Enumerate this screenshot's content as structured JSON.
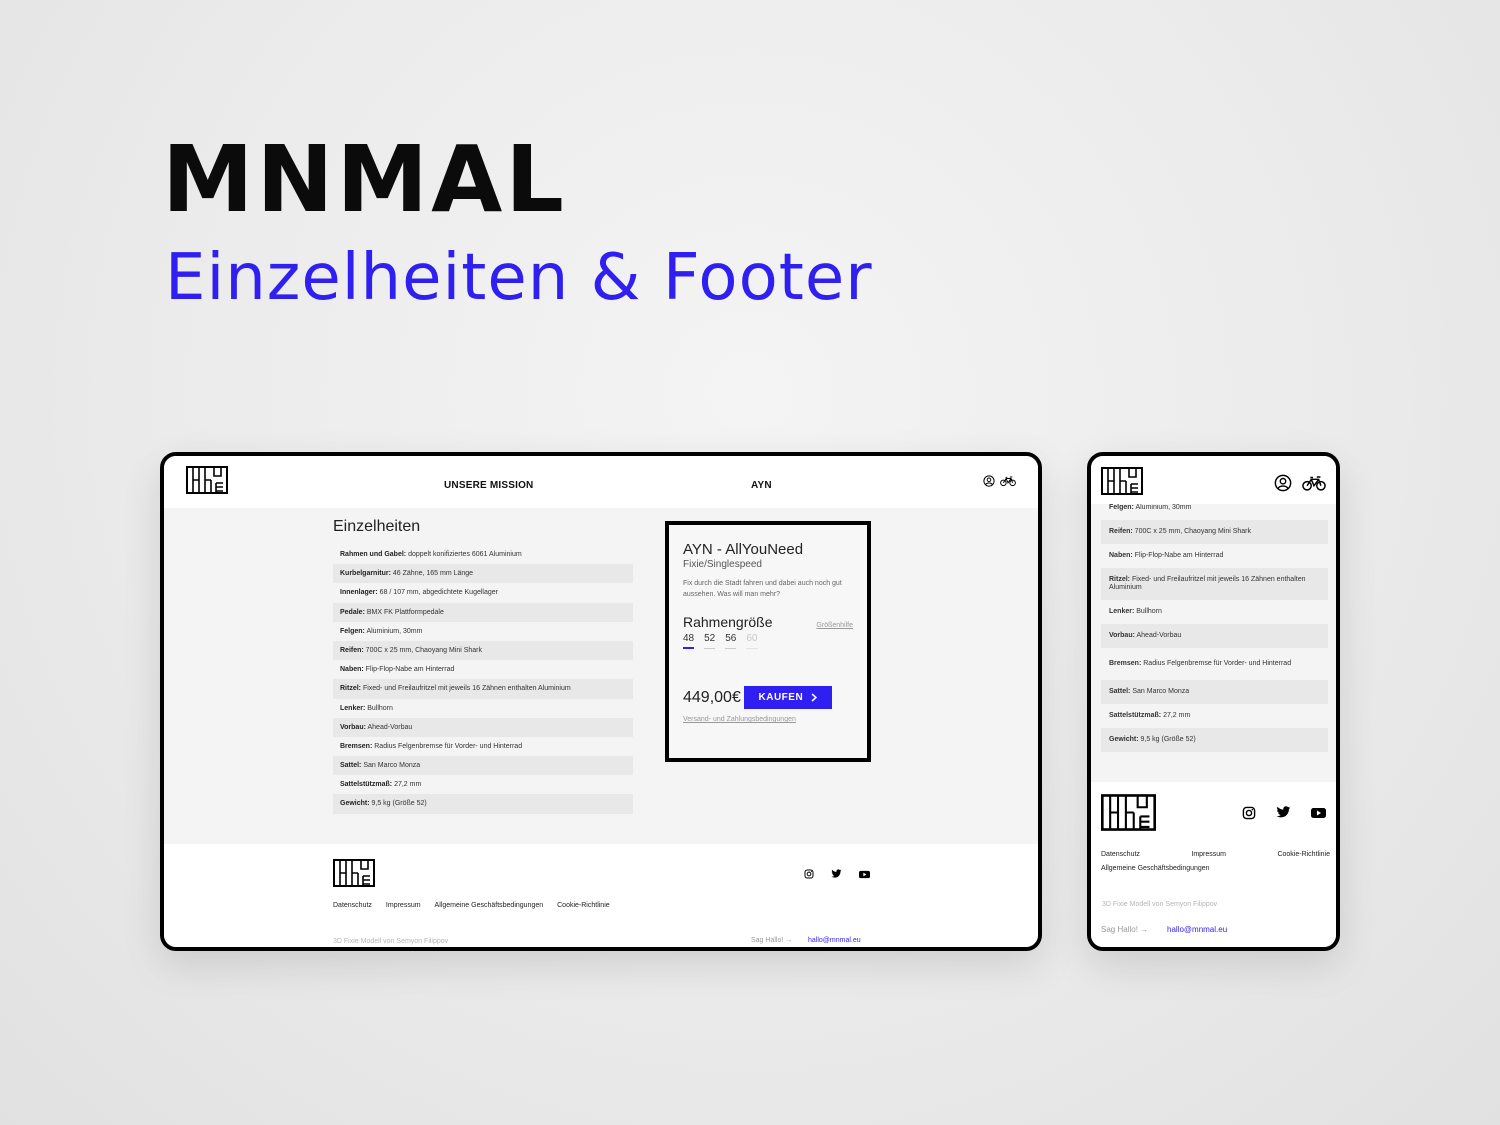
{
  "showcase": {
    "title": "MNMAL",
    "subtitle": "Einzelheiten & Footer"
  },
  "colors": {
    "accent": "#2f1ff0",
    "frame": "#000000",
    "panel": "#f4f4f4"
  },
  "icons": [
    "logo-mark",
    "user-icon",
    "bike-icon",
    "instagram-icon",
    "twitter-icon",
    "youtube-icon",
    "chevron-right-icon",
    "arrow-right-icon"
  ],
  "desktop": {
    "nav": {
      "mission": "UNSERE MISSION",
      "product": "AYN"
    },
    "section_title": "Einzelheiten",
    "specs": [
      {
        "label": "Rahmen und Gabel:",
        "value": " doppelt konifiziertes 6061 Aluminium"
      },
      {
        "label": "Kurbelgarnitur:",
        "value": " 46 Zähne, 165 mm Länge"
      },
      {
        "label": "Innenlager:",
        "value": " 68 / 107 mm, abgedichtete Kugellager"
      },
      {
        "label": "Pedale:",
        "value": " BMX FK Plattformpedale"
      },
      {
        "label": "Felgen:",
        "value": " Aluminium, 30mm"
      },
      {
        "label": "Reifen:",
        "value": " 700C x 25 mm, Chaoyang Mini Shark"
      },
      {
        "label": "Naben:",
        "value": " Flip-Flop-Nabe am Hinterrad"
      },
      {
        "label": "Ritzel:",
        "value": " Fixed- und Freilaufritzel mit jeweils 16 Zähnen enthalten Aluminium"
      },
      {
        "label": "Lenker:",
        "value": " Bullhorn"
      },
      {
        "label": "Vorbau:",
        "value": " Ahead-Vorbau"
      },
      {
        "label": "Bremsen:",
        "value": " Radius Felgenbremse für Vorder- und Hinterrad"
      },
      {
        "label": "Sattel:",
        "value": " San Marco Monza"
      },
      {
        "label": "Sattelstützmaß:",
        "value": " 27,2 mm"
      },
      {
        "label": "Gewicht:",
        "value": " 9,5 kg (Größe 52)"
      }
    ],
    "buybox": {
      "name": "AYN - AllYouNeed",
      "type": "Fixie/Singlespeed",
      "description": "Fix durch die Stadt fahren und dabei auch noch gut aussehen. Was will man mehr?",
      "size_title": "Rahmengröße",
      "size_help": "Größenhilfe",
      "sizes": [
        "48",
        "52",
        "56",
        "60"
      ],
      "selected_size": "48",
      "unavailable_size": "60",
      "price": "449,00€",
      "buy_label": "KAUFEN",
      "shipping": "Versand- und Zahlungsbedingungen"
    },
    "footer": {
      "links": [
        "Datenschutz",
        "Impressum",
        "Allgemeine Geschäftsbedingungen",
        "Cookie-Richtlinie"
      ],
      "credit": "3D Fixie Modell von Semyon Filippov",
      "sayhi": "Sag Hallo! →",
      "email": "hallo@mnmal.eu"
    }
  },
  "mobile": {
    "specs": [
      {
        "label": "Felgen:",
        "value": " Aluminium, 30mm"
      },
      {
        "label": "Reifen:",
        "value": " 700C x 25 mm, Chaoyang Mini Shark"
      },
      {
        "label": "Naben:",
        "value": " Flip-Flop-Nabe am Hinterrad"
      },
      {
        "label": "Ritzel:",
        "value": " Fixed- und Freilaufritzel mit jeweils 16 Zähnen enthalten Aluminium"
      },
      {
        "label": "Lenker:",
        "value": " Bullhorn"
      },
      {
        "label": "Vorbau:",
        "value": " Ahead-Vorbau"
      },
      {
        "label": "Bremsen:",
        "value": " Radius Felgenbremse für Vorder- und Hinterrad"
      },
      {
        "label": "Sattel:",
        "value": " San Marco Monza"
      },
      {
        "label": "Sattelstützmaß:",
        "value": " 27,2 mm"
      },
      {
        "label": "Gewicht:",
        "value": " 9,5 kg (Größe 52)"
      }
    ],
    "footer": {
      "links_row1": [
        "Datenschutz",
        "Impressum",
        "Cookie-Richtlinie"
      ],
      "links_row2": "Allgemeine Geschäftsbedingungen",
      "credit": "3D Fixie Modell von Semyon Filippov",
      "sayhi": "Sag Hallo! →",
      "email": "hallo@mnmal.eu"
    }
  }
}
